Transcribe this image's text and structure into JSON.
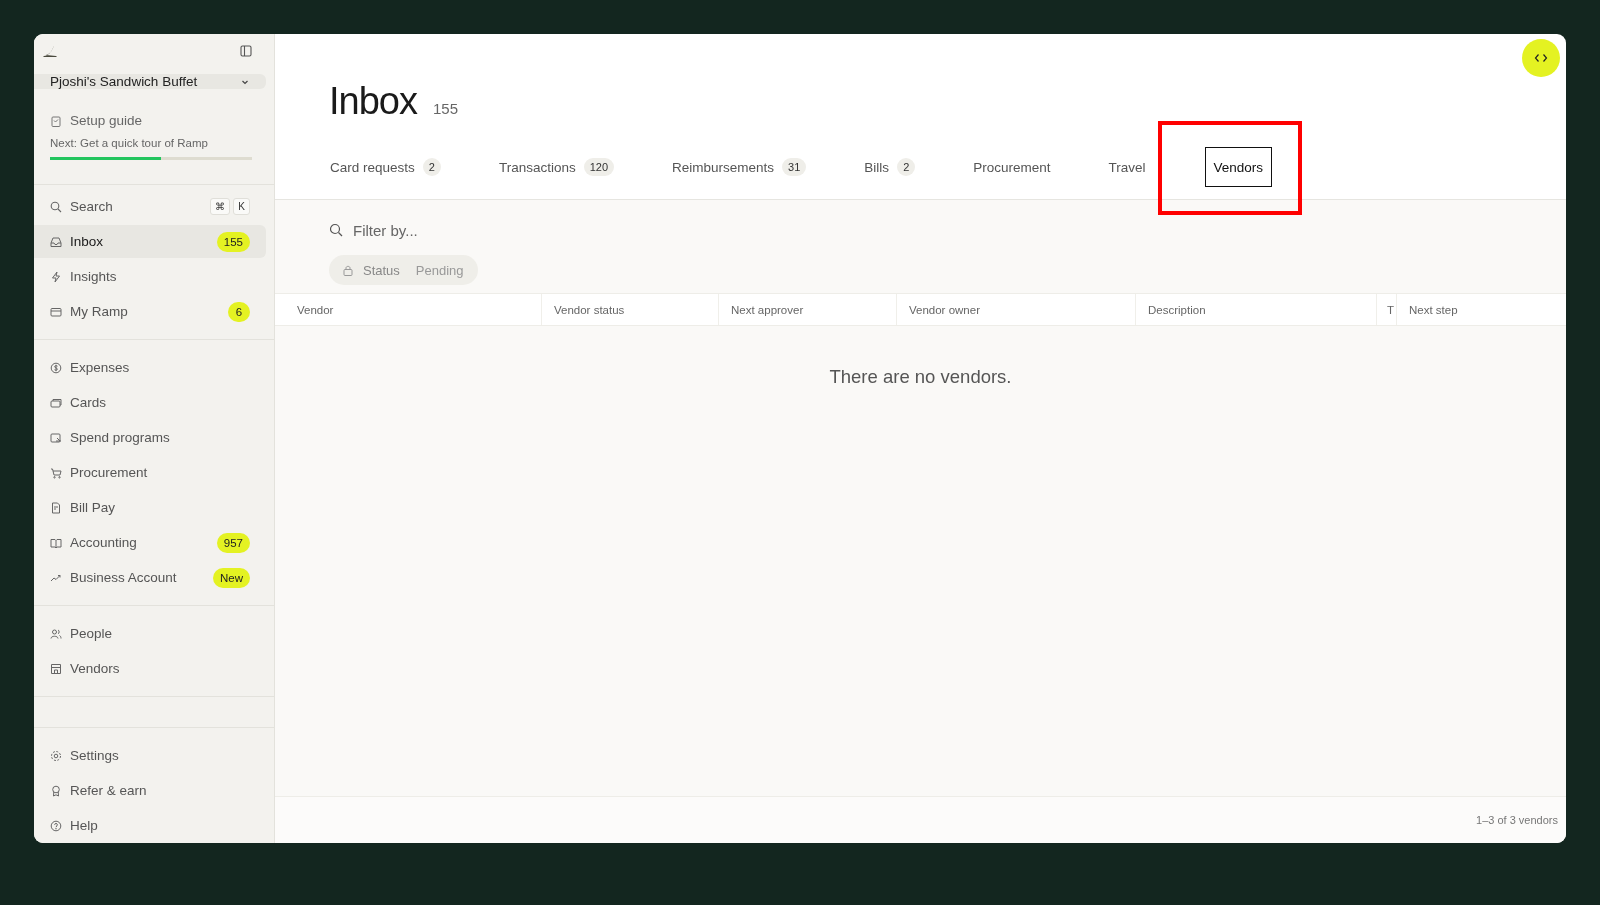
{
  "sidebar": {
    "workspace": {
      "name": "Pjoshi's Sandwich Buffet"
    },
    "setup_guide": {
      "label": "Setup guide",
      "next": "Next: Get a quick tour of Ramp",
      "level": 0.55
    },
    "search": {
      "label": "Search",
      "keys": [
        "⌘",
        "K"
      ]
    },
    "sections": [
      [
        {
          "label": "Inbox",
          "badge": "155",
          "selected": true
        },
        {
          "label": "Insights",
          "selected": false
        },
        {
          "label": "My Ramp",
          "badge": "6",
          "selected": false
        }
      ],
      [
        {
          "label": "Expenses",
          "selected": false
        },
        {
          "label": "Cards",
          "selected": false
        },
        {
          "label": "Spend programs",
          "selected": false
        },
        {
          "label": "Procurement",
          "selected": false
        },
        {
          "label": "Bill Pay",
          "selected": false
        },
        {
          "label": "Accounting",
          "badge": "957",
          "selected": false
        },
        {
          "label": "Business Account",
          "badge": "New",
          "selected": false
        }
      ],
      [
        {
          "label": "People",
          "selected": false
        },
        {
          "label": "Vendors",
          "selected": false
        }
      ],
      [
        {
          "label": "Settings",
          "selected": false
        },
        {
          "label": "Refer & earn",
          "selected": false
        },
        {
          "label": "Help",
          "selected": false
        }
      ]
    ]
  },
  "page": {
    "title": "Inbox",
    "count": "155"
  },
  "tabs": [
    {
      "label": "Card requests",
      "count": "2",
      "selected": false,
      "highlighted": false
    },
    {
      "label": "Transactions",
      "count": "120",
      "selected": false,
      "highlighted": false
    },
    {
      "label": "Reimbursements",
      "count": "31",
      "selected": false,
      "highlighted": false
    },
    {
      "label": "Bills",
      "count": "2",
      "selected": false,
      "highlighted": false
    },
    {
      "label": "Procurement",
      "selected": false,
      "highlighted": false
    },
    {
      "label": "Travel",
      "selected": false,
      "highlighted": false
    },
    {
      "label": "Vendors",
      "selected": true,
      "highlighted": true
    }
  ],
  "filter": {
    "placeholder": "Filter by...",
    "chip": {
      "label": "Status",
      "value": "Pending",
      "locked": true
    }
  },
  "table": {
    "columns": [
      "Vendor",
      "Vendor status",
      "Next approver",
      "Vendor owner",
      "Description",
      "T",
      "Next step"
    ],
    "empty_message": "There are no vendors.",
    "footer": "1–3 of 3 vendors"
  }
}
